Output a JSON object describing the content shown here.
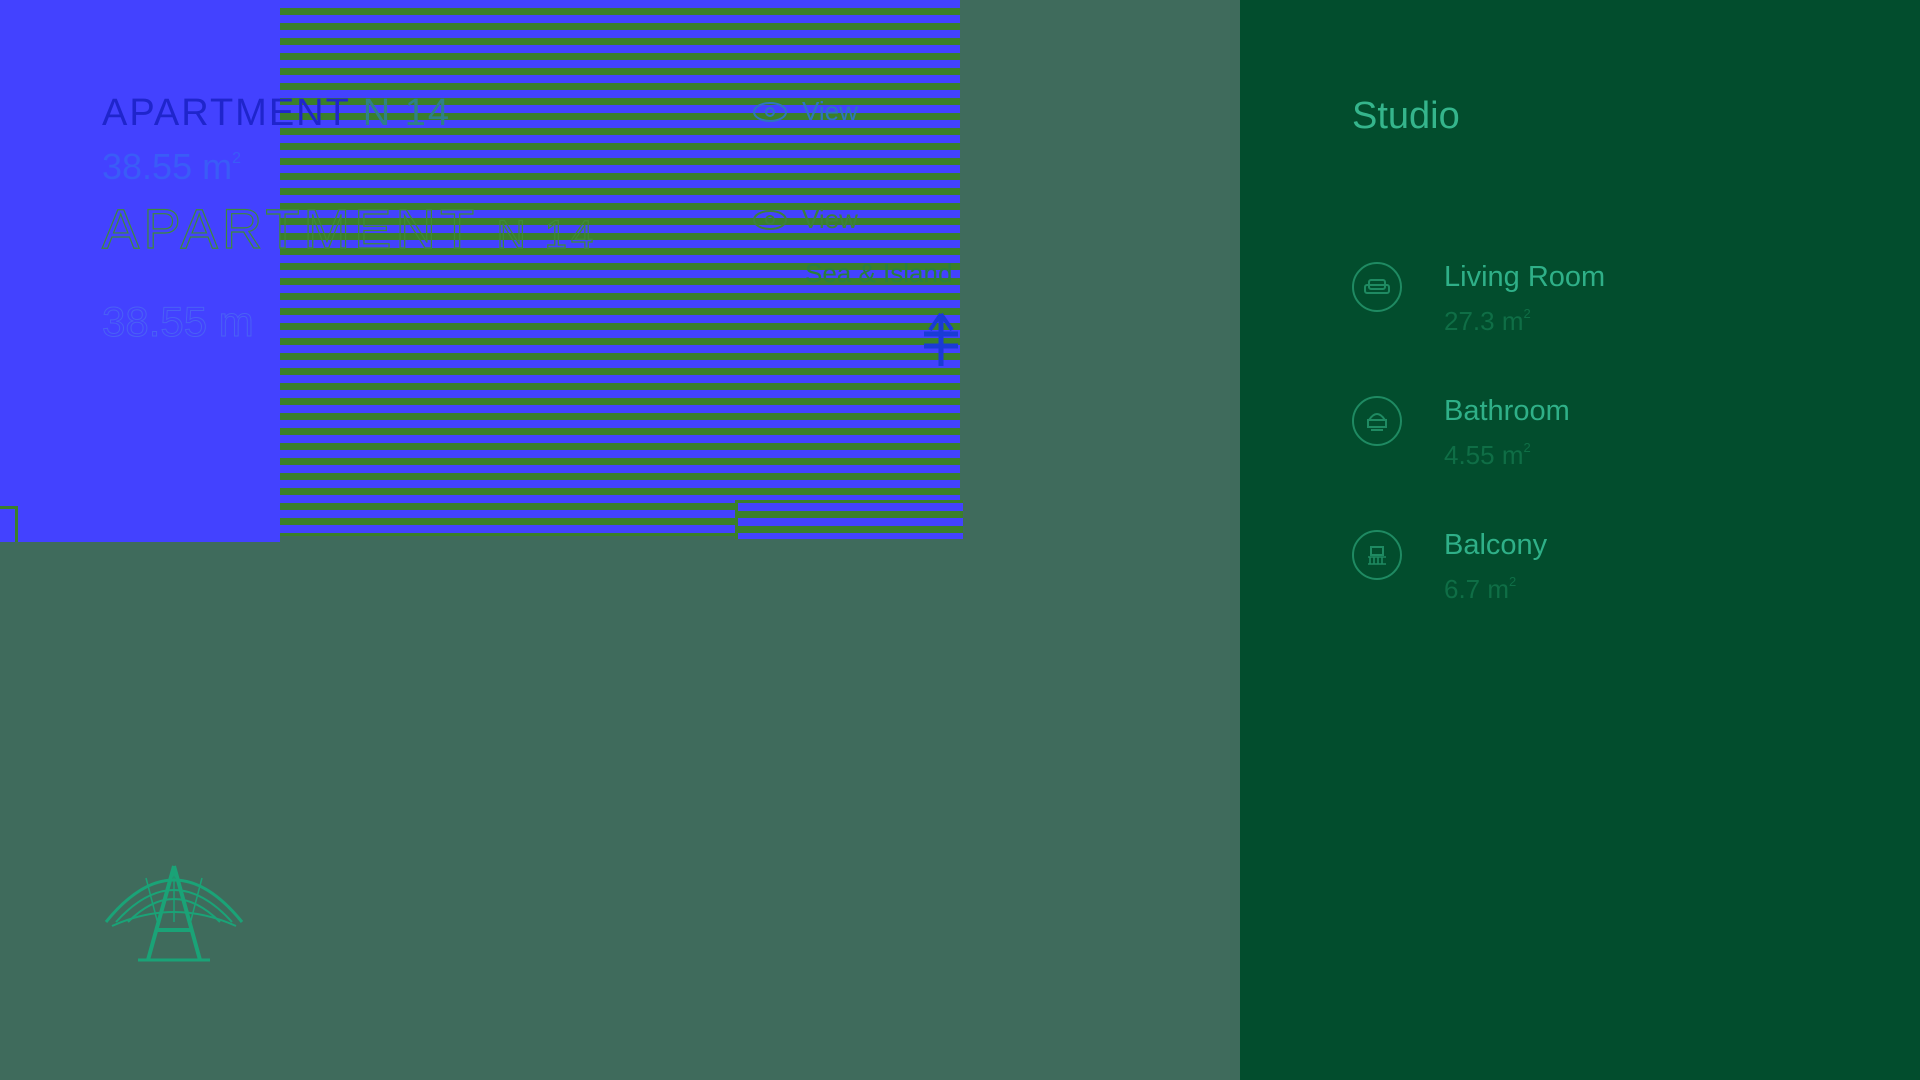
{
  "apartment": {
    "title_word": "APARTMENT",
    "number": "N 14",
    "area": "38.55 m",
    "area_unit_sup": "2"
  },
  "view": {
    "label": "View",
    "value": "Sea & Island"
  },
  "panel": {
    "title": "Studio",
    "rooms": [
      {
        "name": "Living Room",
        "area": "27.3 m",
        "sup": "2",
        "icon": "sofa-icon"
      },
      {
        "name": "Bathroom",
        "area": "4.55 m",
        "sup": "2",
        "icon": "bathtub-icon"
      },
      {
        "name": "Balcony",
        "area": "6.7 m",
        "sup": "2",
        "icon": "balcony-icon"
      }
    ]
  },
  "colors": {
    "background": "#3f6b5c",
    "panel": "#024d2d",
    "accent": "#35b58c",
    "plan_blue": "#4342ff",
    "plan_green": "#3b7f2a"
  }
}
